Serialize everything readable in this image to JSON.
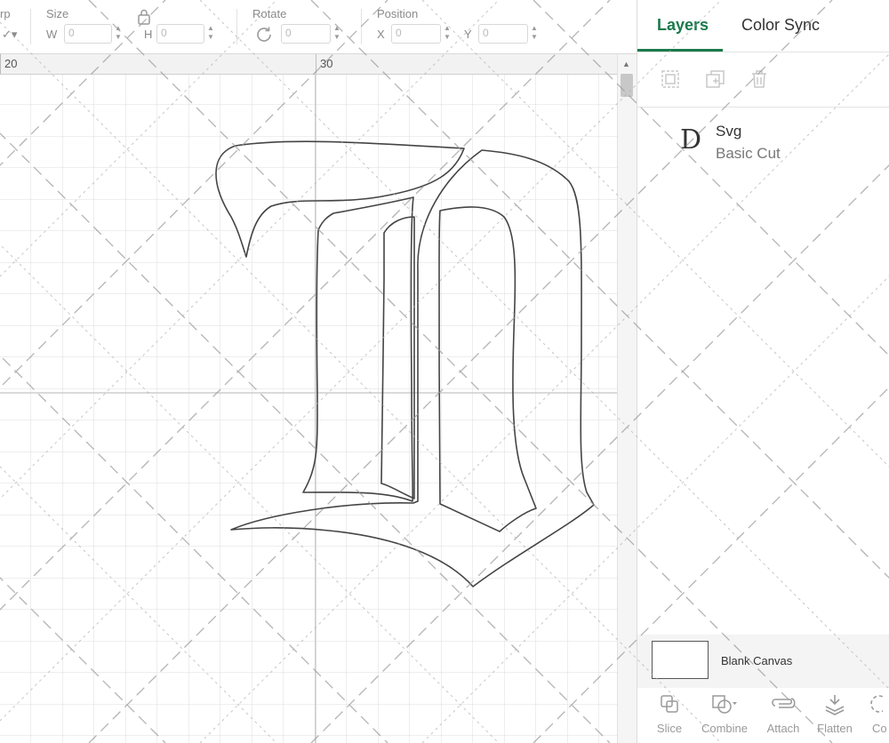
{
  "toolbar": {
    "warp_label": "rp",
    "size_label": "Size",
    "size_w_label": "W",
    "size_w_value": "0",
    "size_h_label": "H",
    "size_h_value": "0",
    "rotate_label": "Rotate",
    "rotate_value": "0",
    "position_label": "Position",
    "position_x_label": "X",
    "position_x_value": "0",
    "position_y_label": "Y",
    "position_y_value": "0"
  },
  "ruler": {
    "top_marks": [
      "20",
      "30"
    ]
  },
  "panel": {
    "tabs": [
      {
        "label": "Layers"
      },
      {
        "label": "Color Sync"
      }
    ],
    "layers": [
      {
        "name": "Svg",
        "operation": "Basic Cut",
        "thumb_glyph": "D"
      }
    ],
    "blank_canvas_label": "Blank Canvas",
    "bottom_tools": [
      {
        "label": "Slice"
      },
      {
        "label": "Combine"
      },
      {
        "label": "Attach"
      },
      {
        "label": "Flatten"
      },
      {
        "label": "Co"
      }
    ]
  },
  "colors": {
    "accent": "#1a7a4a",
    "grid_line": "#dcdcdc",
    "grid_major": "#c4c4c4",
    "shape_stroke": "#444444"
  },
  "icons": {
    "lock": "lock-icon",
    "rotate": "rotate-icon",
    "group": "group-icon",
    "duplicate": "duplicate-icon",
    "delete": "delete-icon",
    "slice": "slice-icon",
    "combine": "combine-icon",
    "attach": "attach-icon",
    "flatten": "flatten-icon"
  }
}
